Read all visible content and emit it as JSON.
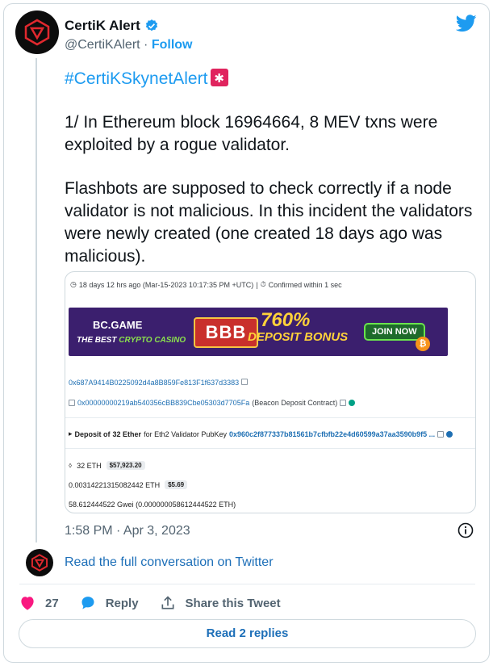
{
  "author": {
    "display_name": "CertiK Alert",
    "handle": "@CertiKAlert",
    "separator": "·",
    "follow_label": "Follow"
  },
  "tweet": {
    "hashtag": "#CertiKSkynetAlert",
    "paragraph1": "1/ In Ethereum block 16964664, 8 MEV txns were exploited by a rogue validator.",
    "paragraph2": "Flashbots are supposed to check correctly if a node validator is not malicious. In this incident the validators were newly created (one created 18 days ago was malicious).",
    "timestamp": "1:58 PM · Apr 3, 2023"
  },
  "media": {
    "time_line": "18 days 12 hrs ago (Mar-15-2023 10:17:35 PM +UTC)",
    "confirmed": "Confirmed within 1 sec",
    "banner": {
      "logo": "BC.GAME",
      "sub_pre": "THE BEST ",
      "sub_hl": "CRYPTO CASINO",
      "bb": "BBB",
      "pct": "760%",
      "bonus": "DEPOSIT BONUS",
      "join": "JOIN NOW"
    },
    "from_address": "0x687A9414B0225092d4a8B859Fe813F1f637d3383",
    "to_address": "0x00000000219ab540356cBB839Cbe05303d7705Fa",
    "to_label": "(Beacon Deposit Contract)",
    "deposit": {
      "prefix": "Deposit of",
      "amount": "32 Ether",
      "middle": "for Eth2 Validator PubKey",
      "pubkey": "0x960c2f877337b81561b7cfbfb22e4d60599a37aa3590b9f5 ..."
    },
    "value_eth": "32 ETH",
    "value_usd": "$57,923.20",
    "fee_eth": "0.00314221315082442 ETH",
    "fee_usd": "$5.69",
    "gas_price": "58.612444522 Gwei (0.000000058612444522 ETH)"
  },
  "footer": {
    "read_full": "Read the full conversation on Twitter",
    "like_count": "27",
    "reply_label": "Reply",
    "share_label": "Share this Tweet",
    "read_replies": "Read 2 replies"
  },
  "colors": {
    "twitter_blue": "#1d9bf0",
    "like_red": "#f91880",
    "text_gray": "#536471"
  },
  "icons": [
    "certik-logo-icon",
    "verified-badge-icon",
    "twitter-bird-icon",
    "siren-emoji-icon",
    "info-icon",
    "heart-icon",
    "reply-bubble-icon",
    "share-icon"
  ]
}
